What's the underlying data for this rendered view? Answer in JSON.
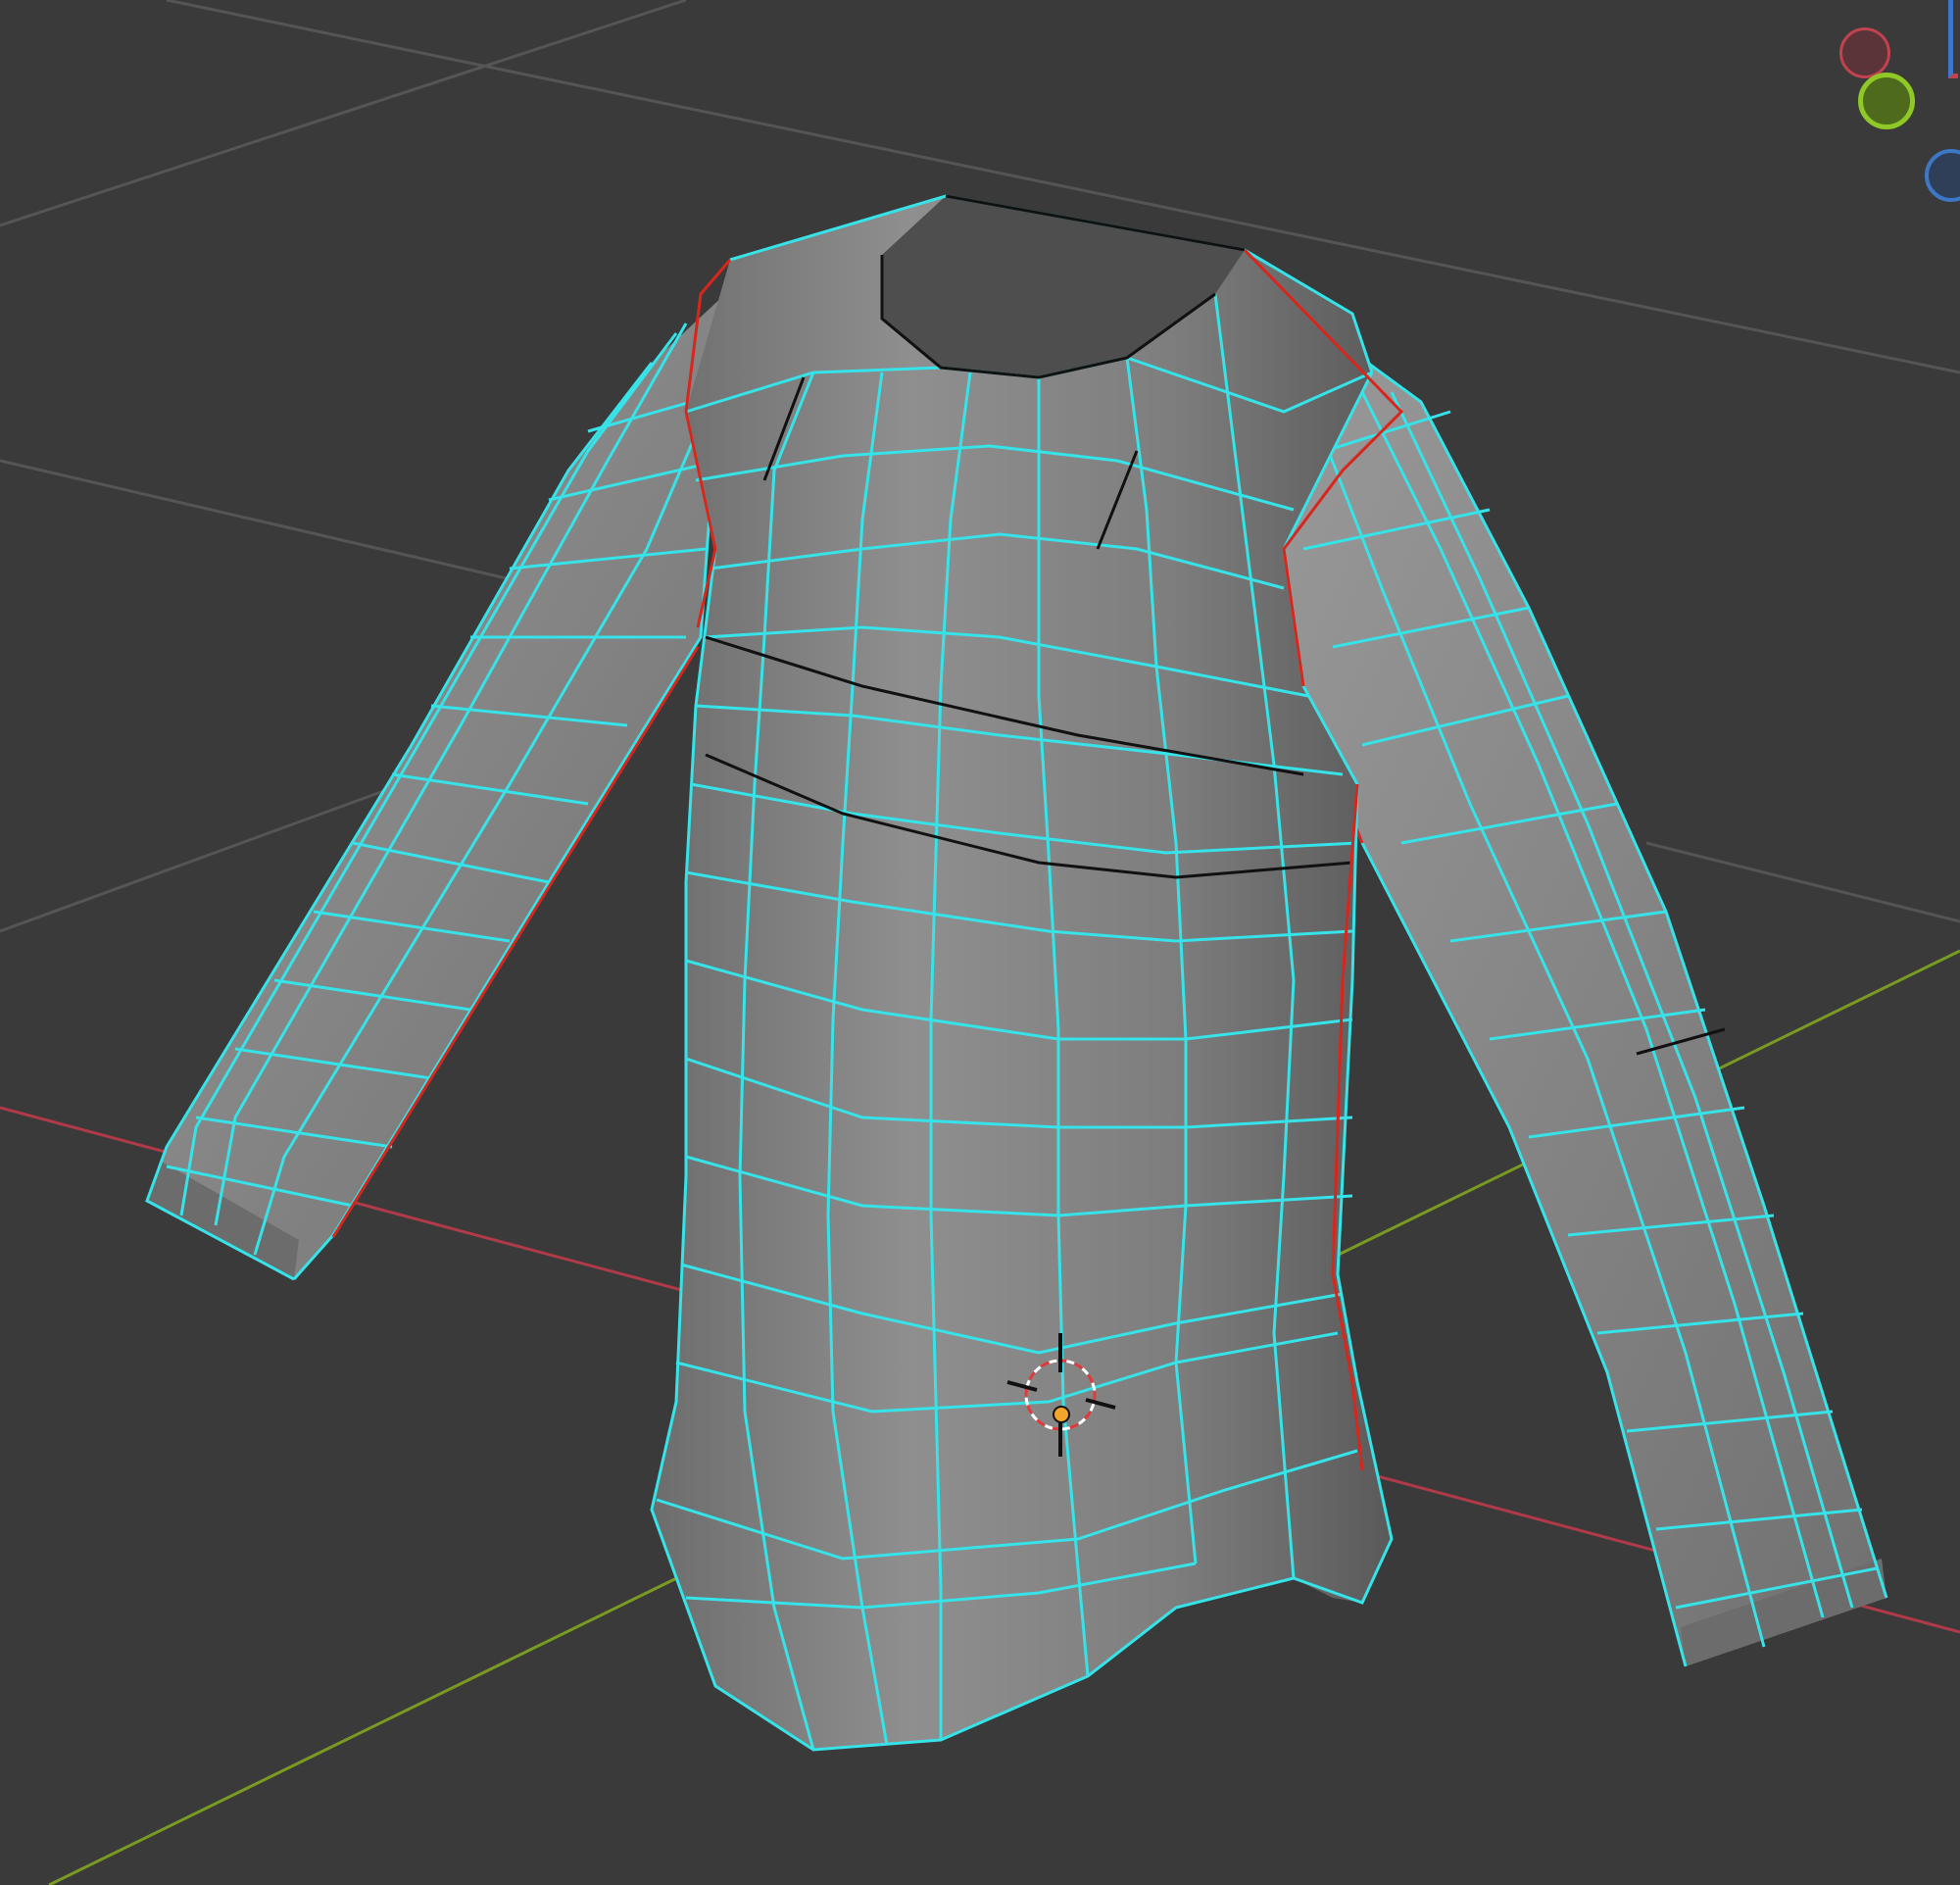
{
  "viewport": {
    "background": "#3a3a3a"
  },
  "colors": {
    "mesh_fill": "#8a8a8a",
    "wire_selected": "#35e3e8",
    "seam": "#d8261c",
    "unselected_edge": "#111111",
    "grid_line": "#555555",
    "axis_x": "#b03a48",
    "axis_y": "#7a9a22",
    "axis_z": "#3d78c8"
  },
  "gizmo": {
    "x_axis": {
      "icon": "axis-x-icon",
      "color": "#c0434e"
    },
    "y_axis": {
      "icon": "axis-y-icon",
      "color": "#8ec926"
    },
    "z_axis": {
      "icon": "axis-z-icon",
      "color": "#3d78c8"
    }
  },
  "objects": {
    "mesh": {
      "icon": "shirt-mesh-icon",
      "mode": "edit",
      "selection": "all"
    },
    "cursor": {
      "icon": "3d-cursor-icon"
    },
    "origin": {
      "icon": "object-origin-icon",
      "color": "#f2a52a"
    }
  }
}
